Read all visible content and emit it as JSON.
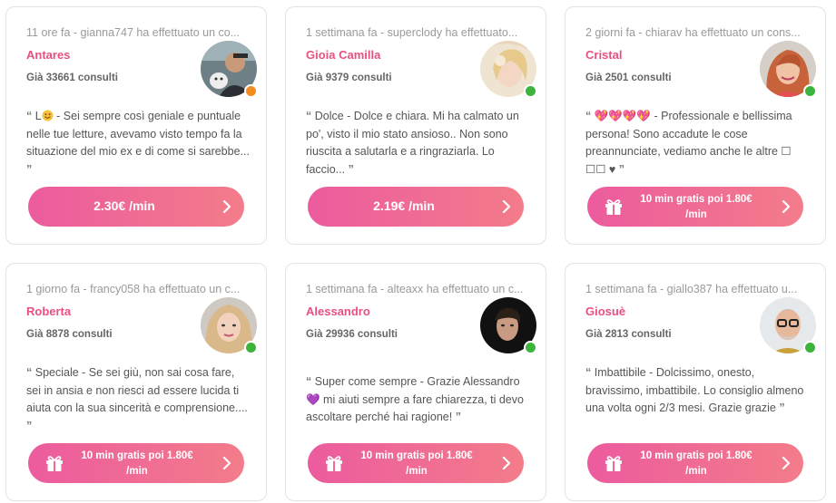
{
  "cards": [
    {
      "meta": "11 ore fa - gianna747 ha effettuato un co...",
      "name": "Antares",
      "consults": "Già 33661 consulti",
      "status": "busy",
      "review_pre": "L",
      "review_post": " - Sei sempre così geniale e puntuale nelle tue letture, avevamo visto tempo fa la situazione del mio ex e di come si sarebbe...",
      "button": "2.30€ /min",
      "button_type": "price"
    },
    {
      "meta": "1 settimana fa - superclody ha effettuato...",
      "name": "Gioia Camilla",
      "consults": "Già 9379 consulti",
      "status": "online",
      "review_pre": "",
      "review_post": "Dolce - Dolce e chiara. Mi ha calmato un po', visto il mio stato ansioso.. Non sono riuscita a salutarla e a ringraziarla. Lo faccio...",
      "button": "2.19€ /min",
      "button_type": "price"
    },
    {
      "meta": "2 giorni fa - chiarav ha effettuato un cons...",
      "name": "Cristal",
      "consults": "Già 2501 consulti",
      "status": "online",
      "review_pre": "💖💖💖💖",
      "review_post": " - Professionale e bellissima persona! Sono accadute le cose preannunciate, vediamo anche le altre ☐ ☐☐ ♥",
      "button": "10 min gratis poi 1.80€ /min",
      "button_type": "promo"
    },
    {
      "meta": "1 giorno fa - francy058 ha effettuato un c...",
      "name": "Roberta",
      "consults": "Già 8878 consulti",
      "status": "online",
      "review_pre": "",
      "review_post": "Speciale - Se sei giù, non sai cosa fare, sei in ansia e non riesci ad essere lucida ti aiuta con la sua sincerità e comprensione....",
      "button": "10 min gratis poi 1.80€ /min",
      "button_type": "promo"
    },
    {
      "meta": "1 settimana fa - alteaxx ha effettuato un c...",
      "name": "Alessandro",
      "consults": "Già 29936 consulti",
      "status": "online",
      "review_pre": "",
      "review_post": "Super come sempre - Grazie Alessandro 💜 mi aiuti sempre a fare chiarezza, ti devo ascoltare perché hai ragione!",
      "button": "10 min gratis poi 1.80€ /min",
      "button_type": "promo"
    },
    {
      "meta": "1 settimana fa - giallo387 ha effettuato u...",
      "name": "Giosuè",
      "consults": "Già 2813 consulti",
      "status": "online",
      "review_pre": "",
      "review_post": "Imbattibile - Dolcissimo, onesto, bravissimo, imbattibile. Lo consiglio almeno una volta ogni 2/3 mesi. Grazie grazie",
      "button": "10 min gratis poi 1.80€ /min",
      "button_type": "promo"
    }
  ],
  "quote_open": "“",
  "quote_close": "”",
  "colors": {
    "accent": "#e8507f",
    "online": "#3cb43c",
    "busy": "#f28c1e"
  },
  "icons": {
    "gift": "gift-icon",
    "chevron": "chevron-right-icon",
    "smiley": "smiley-icon"
  }
}
